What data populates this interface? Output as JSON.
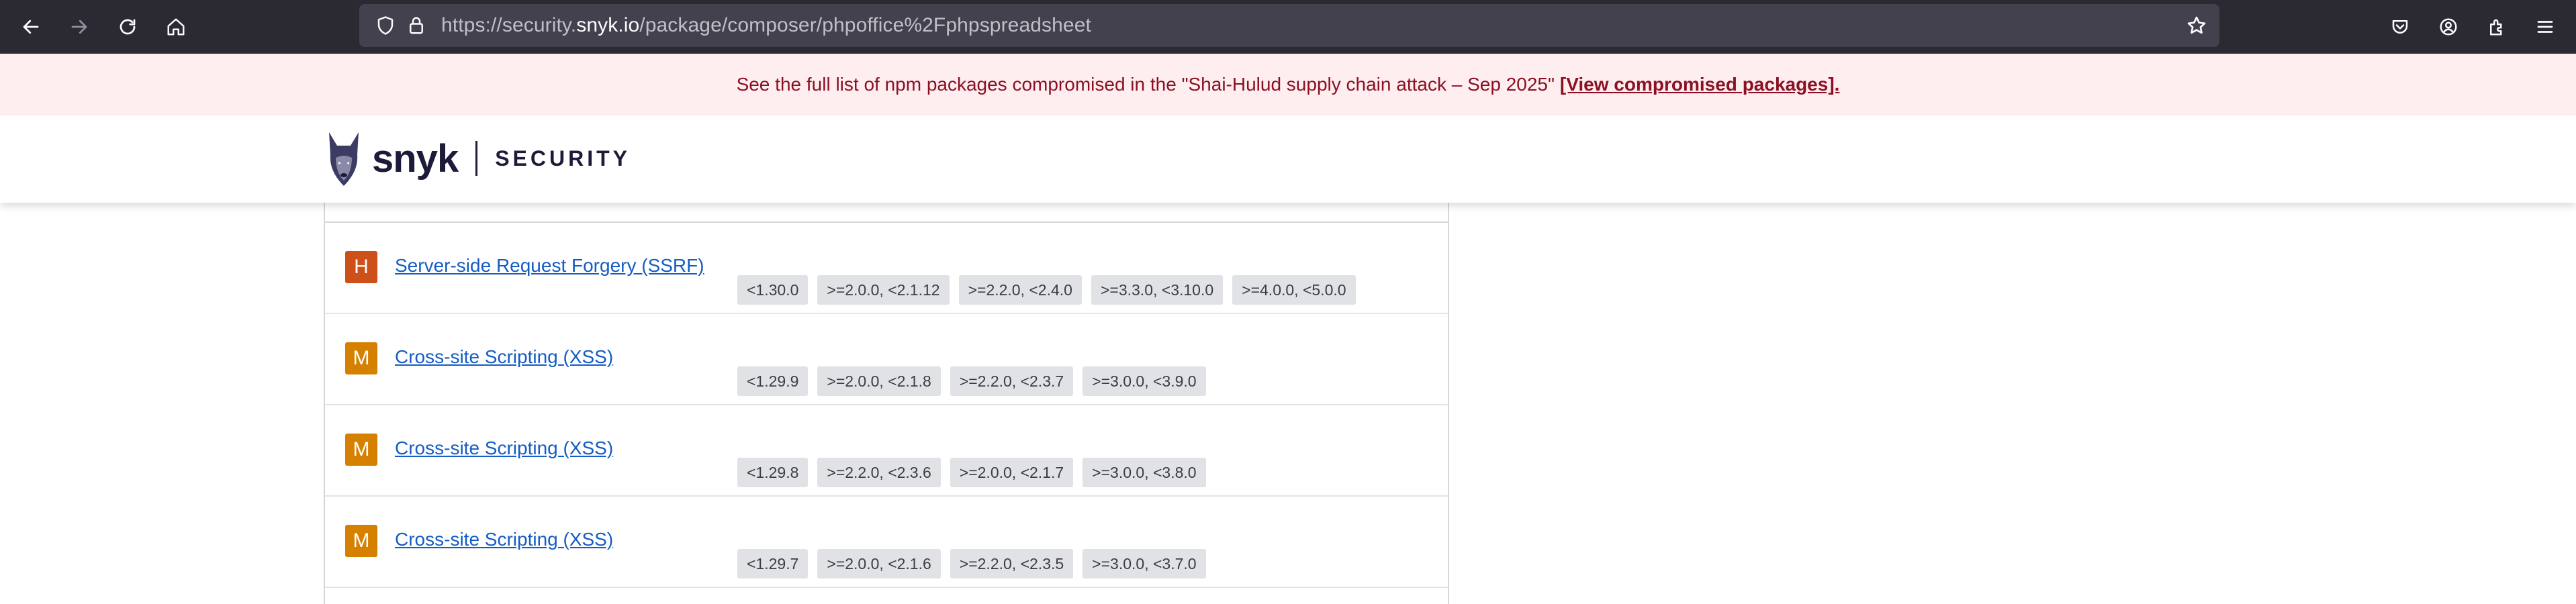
{
  "browser": {
    "url_prefix": "https://security.",
    "url_host": "snyk.io",
    "url_path": "/package/composer/phpoffice%2Fphpspreadsheet",
    "icons": [
      "back-icon",
      "forward-icon",
      "reload-icon",
      "home-icon",
      "shield-icon",
      "lock-icon",
      "star-icon",
      "pocket-icon",
      "account-icon",
      "extensions-icon",
      "menu-icon"
    ]
  },
  "banner": {
    "text": "See the full list of npm packages compromised in the \"Shai-Hulud supply chain attack – Sep 2025\"",
    "link": "[View compromised packages]."
  },
  "header": {
    "logo_word": "snyk",
    "logo_sub": "SECURITY"
  },
  "colors": {
    "high": "#ce5019",
    "medium": "#d68000",
    "link": "#145cc4",
    "banner_text": "#8b1023"
  },
  "vulnerabilities": [
    {
      "severity": "H",
      "title": "Server-side Request Forgery (SSRF)",
      "ranges": [
        "<1.30.0",
        ">=2.0.0, <2.1.12",
        ">=2.2.0, <2.4.0",
        ">=3.3.0, <3.10.0",
        ">=4.0.0, <5.0.0"
      ]
    },
    {
      "severity": "M",
      "title": "Cross-site Scripting (XSS)",
      "ranges": [
        "<1.29.9",
        ">=2.0.0, <2.1.8",
        ">=2.2.0, <2.3.7",
        ">=3.0.0, <3.9.0"
      ]
    },
    {
      "severity": "M",
      "title": "Cross-site Scripting (XSS)",
      "ranges": [
        "<1.29.8",
        ">=2.2.0, <2.3.6",
        ">=2.0.0, <2.1.7",
        ">=3.0.0, <3.8.0"
      ]
    },
    {
      "severity": "M",
      "title": "Cross-site Scripting (XSS)",
      "ranges": [
        "<1.29.7",
        ">=2.0.0, <2.1.6",
        ">=2.2.0, <2.3.5",
        ">=3.0.0, <3.7.0"
      ]
    }
  ]
}
